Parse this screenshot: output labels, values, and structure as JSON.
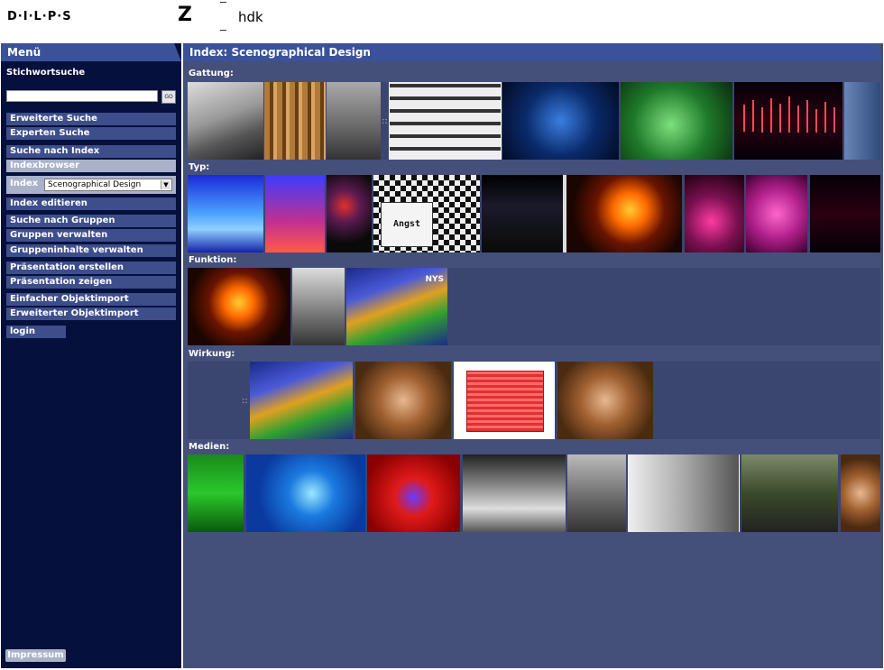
{
  "header": {
    "logo_dilips": "D·I·L·P·S",
    "logo_z": "Z",
    "logo_hdk": "hdk"
  },
  "sidebar": {
    "title": "Menü",
    "search_label": "Stichwortsuche",
    "search_value": "",
    "go_label": "GO",
    "items": [
      {
        "label": "Erweiterte Suche"
      },
      {
        "label": "Experten Suche"
      },
      {
        "label": "Suche nach Index"
      },
      {
        "label": "Indexbrowser"
      },
      {
        "label": "Index editieren"
      },
      {
        "label": "Suche nach Gruppen"
      },
      {
        "label": "Gruppen verwalten"
      },
      {
        "label": "Gruppeninhalte verwalten"
      },
      {
        "label": "Präsentation erstellen"
      },
      {
        "label": "Präsentation zeigen"
      },
      {
        "label": "Einfacher Objektimport"
      },
      {
        "label": "Erweiterter Objektimport"
      }
    ],
    "index_label": "Index",
    "index_selected": "Scenographical Design",
    "login_label": "login",
    "impressum_label": "Impressum"
  },
  "main": {
    "title": "Index: Scenographical Design",
    "sections": [
      {
        "label": "Gattung:"
      },
      {
        "label": "Typ:"
      },
      {
        "label": "Funktion:"
      },
      {
        "label": "Wirkung:"
      },
      {
        "label": "Medien:"
      }
    ],
    "thumb_text_angst": "Angst",
    "thumb_text_nys": "NYS"
  },
  "colors": {
    "sidebar_bg": "#05103d",
    "header_bar": "#3b5199",
    "main_bg": "#44507a",
    "button_bg": "#3d4e8b",
    "button_active": "#a9b2c9"
  }
}
